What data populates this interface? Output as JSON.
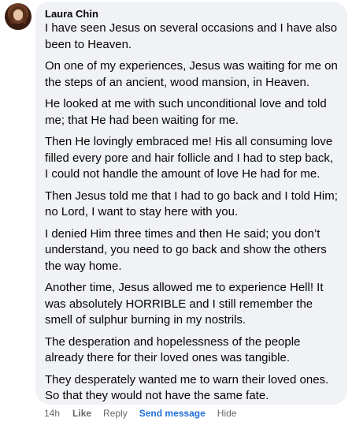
{
  "comment": {
    "author": "Laura Chin",
    "paragraphs": [
      "I have seen Jesus on several occasions and I have also been to Heaven.",
      "On one of my experiences, Jesus was waiting for me on the steps of an ancient, wood mansion, in Heaven.",
      "He looked at me with such unconditional love and told me; that He had been waiting for me.",
      "Then He lovingly embraced me! His all consuming love filled every pore and hair follicle and I had to step back, I could not handle the amount of love He had for me.",
      "Then Jesus told me that I had to go back and I told Him; no Lord, I want to stay here with you.",
      "I denied Him three times and then He said; you don’t understand, you need to go back and show the others the way home.",
      "Another time, Jesus allowed me to experience Hell! It was absolutely HORRIBLE and I still remember the smell of sulphur burning in my nostrils.",
      "The desperation and hopelessness of the people already there for their loved ones was tangible.",
      "They desperately wanted me to warn their loved ones. So that they would not have the same fate."
    ]
  },
  "actions": {
    "time": "14h",
    "like": "Like",
    "reply": "Reply",
    "send_message": "Send message",
    "hide": "Hide"
  },
  "colors": {
    "bubble_bg": "#f0f2f5",
    "text": "#050505",
    "meta": "#65676b",
    "link": "#216fdb"
  }
}
